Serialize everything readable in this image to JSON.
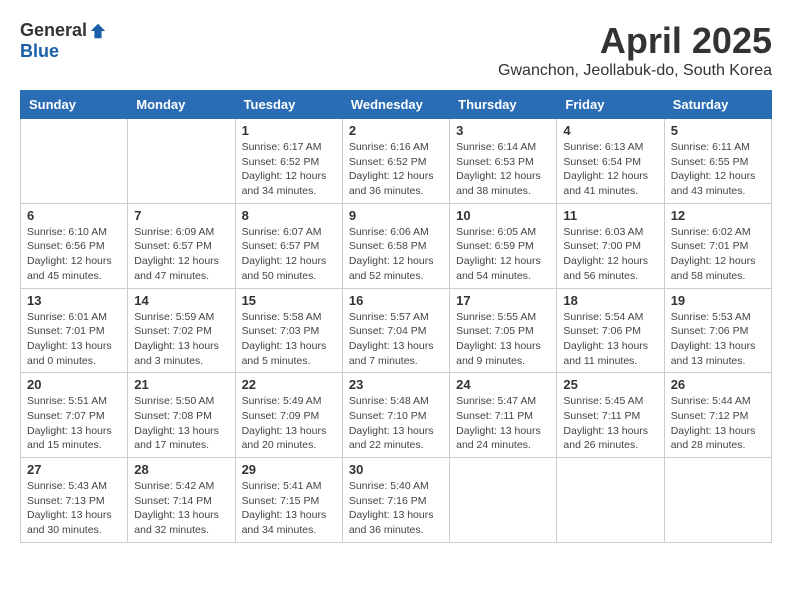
{
  "header": {
    "logo_general": "General",
    "logo_blue": "Blue",
    "title": "April 2025",
    "subtitle": "Gwanchon, Jeollabuk-do, South Korea"
  },
  "weekdays": [
    "Sunday",
    "Monday",
    "Tuesday",
    "Wednesday",
    "Thursday",
    "Friday",
    "Saturday"
  ],
  "weeks": [
    [
      {
        "day": "",
        "info": ""
      },
      {
        "day": "",
        "info": ""
      },
      {
        "day": "1",
        "info": "Sunrise: 6:17 AM\nSunset: 6:52 PM\nDaylight: 12 hours\nand 34 minutes."
      },
      {
        "day": "2",
        "info": "Sunrise: 6:16 AM\nSunset: 6:52 PM\nDaylight: 12 hours\nand 36 minutes."
      },
      {
        "day": "3",
        "info": "Sunrise: 6:14 AM\nSunset: 6:53 PM\nDaylight: 12 hours\nand 38 minutes."
      },
      {
        "day": "4",
        "info": "Sunrise: 6:13 AM\nSunset: 6:54 PM\nDaylight: 12 hours\nand 41 minutes."
      },
      {
        "day": "5",
        "info": "Sunrise: 6:11 AM\nSunset: 6:55 PM\nDaylight: 12 hours\nand 43 minutes."
      }
    ],
    [
      {
        "day": "6",
        "info": "Sunrise: 6:10 AM\nSunset: 6:56 PM\nDaylight: 12 hours\nand 45 minutes."
      },
      {
        "day": "7",
        "info": "Sunrise: 6:09 AM\nSunset: 6:57 PM\nDaylight: 12 hours\nand 47 minutes."
      },
      {
        "day": "8",
        "info": "Sunrise: 6:07 AM\nSunset: 6:57 PM\nDaylight: 12 hours\nand 50 minutes."
      },
      {
        "day": "9",
        "info": "Sunrise: 6:06 AM\nSunset: 6:58 PM\nDaylight: 12 hours\nand 52 minutes."
      },
      {
        "day": "10",
        "info": "Sunrise: 6:05 AM\nSunset: 6:59 PM\nDaylight: 12 hours\nand 54 minutes."
      },
      {
        "day": "11",
        "info": "Sunrise: 6:03 AM\nSunset: 7:00 PM\nDaylight: 12 hours\nand 56 minutes."
      },
      {
        "day": "12",
        "info": "Sunrise: 6:02 AM\nSunset: 7:01 PM\nDaylight: 12 hours\nand 58 minutes."
      }
    ],
    [
      {
        "day": "13",
        "info": "Sunrise: 6:01 AM\nSunset: 7:01 PM\nDaylight: 13 hours\nand 0 minutes."
      },
      {
        "day": "14",
        "info": "Sunrise: 5:59 AM\nSunset: 7:02 PM\nDaylight: 13 hours\nand 3 minutes."
      },
      {
        "day": "15",
        "info": "Sunrise: 5:58 AM\nSunset: 7:03 PM\nDaylight: 13 hours\nand 5 minutes."
      },
      {
        "day": "16",
        "info": "Sunrise: 5:57 AM\nSunset: 7:04 PM\nDaylight: 13 hours\nand 7 minutes."
      },
      {
        "day": "17",
        "info": "Sunrise: 5:55 AM\nSunset: 7:05 PM\nDaylight: 13 hours\nand 9 minutes."
      },
      {
        "day": "18",
        "info": "Sunrise: 5:54 AM\nSunset: 7:06 PM\nDaylight: 13 hours\nand 11 minutes."
      },
      {
        "day": "19",
        "info": "Sunrise: 5:53 AM\nSunset: 7:06 PM\nDaylight: 13 hours\nand 13 minutes."
      }
    ],
    [
      {
        "day": "20",
        "info": "Sunrise: 5:51 AM\nSunset: 7:07 PM\nDaylight: 13 hours\nand 15 minutes."
      },
      {
        "day": "21",
        "info": "Sunrise: 5:50 AM\nSunset: 7:08 PM\nDaylight: 13 hours\nand 17 minutes."
      },
      {
        "day": "22",
        "info": "Sunrise: 5:49 AM\nSunset: 7:09 PM\nDaylight: 13 hours\nand 20 minutes."
      },
      {
        "day": "23",
        "info": "Sunrise: 5:48 AM\nSunset: 7:10 PM\nDaylight: 13 hours\nand 22 minutes."
      },
      {
        "day": "24",
        "info": "Sunrise: 5:47 AM\nSunset: 7:11 PM\nDaylight: 13 hours\nand 24 minutes."
      },
      {
        "day": "25",
        "info": "Sunrise: 5:45 AM\nSunset: 7:11 PM\nDaylight: 13 hours\nand 26 minutes."
      },
      {
        "day": "26",
        "info": "Sunrise: 5:44 AM\nSunset: 7:12 PM\nDaylight: 13 hours\nand 28 minutes."
      }
    ],
    [
      {
        "day": "27",
        "info": "Sunrise: 5:43 AM\nSunset: 7:13 PM\nDaylight: 13 hours\nand 30 minutes."
      },
      {
        "day": "28",
        "info": "Sunrise: 5:42 AM\nSunset: 7:14 PM\nDaylight: 13 hours\nand 32 minutes."
      },
      {
        "day": "29",
        "info": "Sunrise: 5:41 AM\nSunset: 7:15 PM\nDaylight: 13 hours\nand 34 minutes."
      },
      {
        "day": "30",
        "info": "Sunrise: 5:40 AM\nSunset: 7:16 PM\nDaylight: 13 hours\nand 36 minutes."
      },
      {
        "day": "",
        "info": ""
      },
      {
        "day": "",
        "info": ""
      },
      {
        "day": "",
        "info": ""
      }
    ]
  ]
}
